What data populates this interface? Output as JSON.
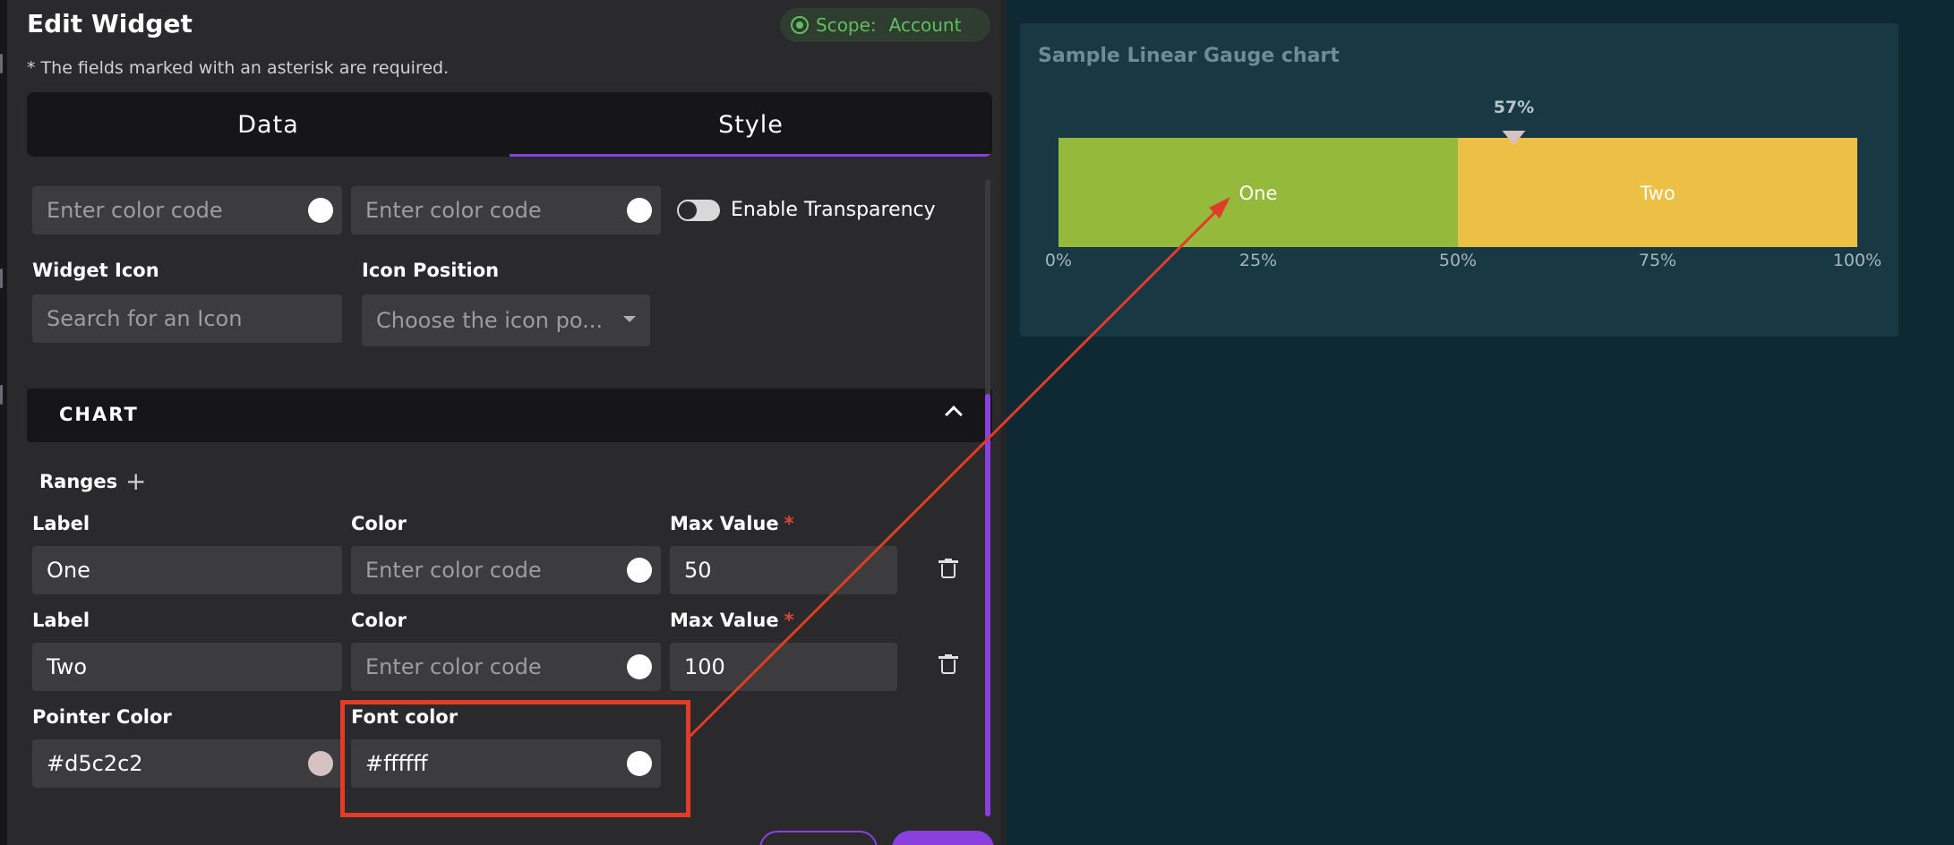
{
  "editor": {
    "title": "Edit Widget",
    "scope_label": "Scope:",
    "scope_value": "Account",
    "required_note": "* The fields marked with an asterisk are required.",
    "tabs": [
      {
        "label": "Data",
        "active": false
      },
      {
        "label": "Style",
        "active": true
      }
    ]
  },
  "style": {
    "color_code_placeholder": "Enter color code",
    "enable_transparency_label": "Enable Transparency",
    "enable_transparency_on": false,
    "widget_icon_label": "Widget Icon",
    "widget_icon_placeholder": "Search for an Icon",
    "icon_position_label": "Icon Position",
    "icon_position_placeholder": "Choose the icon po..."
  },
  "chart_section": {
    "title": "CHART",
    "ranges_label": "Ranges",
    "ranges": [
      {
        "label_caption": "Label",
        "label_value": "One",
        "color_caption": "Color",
        "color_placeholder": "Enter color code",
        "max_caption": "Max Value",
        "max_required": "*",
        "max_value": "50"
      },
      {
        "label_caption": "Label",
        "label_value": "Two",
        "color_caption": "Color",
        "color_placeholder": "Enter color code",
        "max_caption": "Max Value",
        "max_required": "*",
        "max_value": "100"
      }
    ],
    "pointer_color_label": "Pointer Color",
    "pointer_color_value": "#d5c2c2",
    "font_color_label": "Font color",
    "font_color_value": "#ffffff"
  },
  "preview": {
    "card_title": "Sample Linear Gauge chart"
  },
  "chart_data": {
    "type": "linear-gauge",
    "title": "Sample Linear Gauge chart",
    "pointer_value": 57,
    "pointer_label": "57%",
    "pointer_color": "#d5c2c2",
    "font_color": "#ffffff",
    "range": [
      0,
      100
    ],
    "segments": [
      {
        "name": "One",
        "from": 0,
        "to": 50,
        "color": "#95b93b"
      },
      {
        "name": "Two",
        "from": 50,
        "to": 100,
        "color": "#ecbf45"
      }
    ],
    "tick_labels": [
      "0%",
      "25%",
      "50%",
      "75%",
      "100%"
    ],
    "tick_values": [
      0,
      25,
      50,
      75,
      100
    ]
  },
  "colors": {
    "accent": "#8a3fe0",
    "highlight": "#e03c28",
    "scope_green": "#5fbf5e"
  }
}
